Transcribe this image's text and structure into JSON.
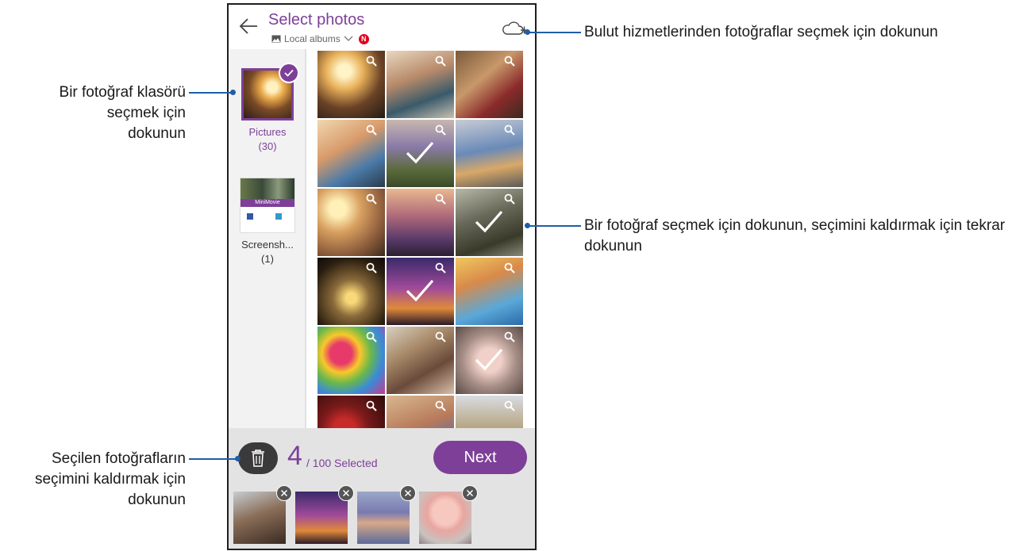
{
  "header": {
    "title": "Select photos",
    "subtitle": "Local albums",
    "badge": "N"
  },
  "albums": [
    {
      "name": "Pictures",
      "count": "(30)",
      "selected": true
    },
    {
      "name": "Screensh...",
      "count": "(1)",
      "selected": false,
      "thumb_text": "MiniMovie"
    }
  ],
  "photos": [
    {
      "selected": false
    },
    {
      "selected": false
    },
    {
      "selected": false
    },
    {
      "selected": false
    },
    {
      "selected": true
    },
    {
      "selected": false
    },
    {
      "selected": false
    },
    {
      "selected": false
    },
    {
      "selected": true
    },
    {
      "selected": false
    },
    {
      "selected": true
    },
    {
      "selected": false
    },
    {
      "selected": false
    },
    {
      "selected": false
    },
    {
      "selected": true
    },
    {
      "selected": false
    },
    {
      "selected": false
    },
    {
      "selected": false
    }
  ],
  "selection": {
    "count": "4",
    "suffix": "/ 100 Selected",
    "next_label": "Next"
  },
  "callouts": {
    "cloud": "Bulut hizmetlerinden fotoğraflar seçmek için dokunun",
    "album": "Bir fotoğraf klasörü seçmek için dokunun",
    "photo": "Bir fotoğraf seçmek için dokunun, seçimini kaldırmak için tekrar dokunun",
    "clear": "Seçilen fotoğrafların seçimini kaldırmak için dokunun"
  },
  "colors": {
    "accent": "#7d3f98",
    "callout_line": "#1f5ea8",
    "bottom_bar": "#e3e3e3"
  }
}
